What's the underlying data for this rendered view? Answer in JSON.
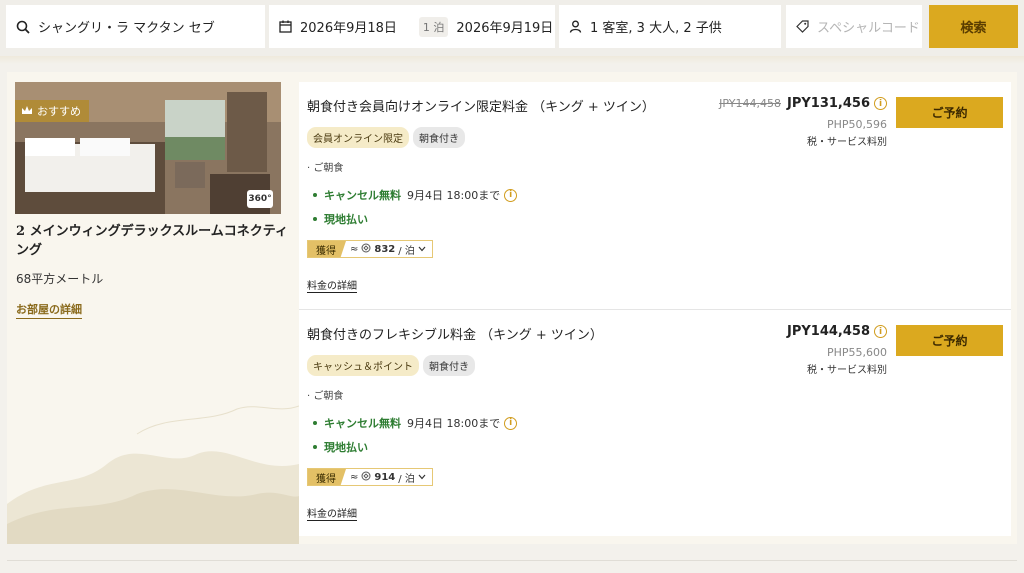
{
  "search": {
    "hotel": "シャングリ・ラ マクタン セブ",
    "checkin": "2026年9月18日",
    "nights": "1 泊",
    "checkout": "2026年9月19日",
    "guests": "1 客室, 3 大人, 2 子供",
    "code_placeholder": "スペシャルコード",
    "search_label": "検索"
  },
  "room": {
    "badge": "おすすめ",
    "name": "2 メインウィングデラックスルームコネクティング",
    "size": "68平方メートル",
    "details_link": "お部屋の詳細",
    "badge_360": "360°"
  },
  "rates": [
    {
      "title": "朝食付き会員向けオンライン限定料金 （キング + ツイン）",
      "tags": [
        "会員オンライン限定",
        "朝食付き"
      ],
      "breakfast": "· ご朝食",
      "cancel_label": "キャンセル無料",
      "cancel_date": "9月4日 18:00まで",
      "pay": "現地払い",
      "earn_label": "獲得",
      "earn_prefix": "≈",
      "earn_points": "832",
      "earn_unit": "/ 泊",
      "detail_link": "料金の詳細",
      "original_price": "JPY144,458",
      "price": "JPY131,456",
      "php": "PHP50,596",
      "tax": "税・サービス料別",
      "book_label": "ご予約"
    },
    {
      "title": "朝食付きのフレキシブル料金 （キング + ツイン）",
      "tags": [
        "キャッシュ＆ポイント",
        "朝食付き"
      ],
      "breakfast": "· ご朝食",
      "cancel_label": "キャンセル無料",
      "cancel_date": "9月4日 18:00まで",
      "pay": "現地払い",
      "earn_label": "獲得",
      "earn_prefix": "≈",
      "earn_points": "914",
      "earn_unit": "/ 泊",
      "detail_link": "料金の詳細",
      "original_price": "",
      "price": "JPY144,458",
      "php": "PHP55,600",
      "tax": "税・サービス料別",
      "book_label": "ご予約"
    }
  ],
  "colors": {
    "accent": "#dba91f",
    "badge": "#b08b38",
    "green": "#2e7d32",
    "card_bg": "#f9f6ee"
  },
  "icons": [
    "search-icon",
    "calendar-icon",
    "person-icon",
    "tag-icon",
    "crown-icon",
    "info-icon",
    "points-icon",
    "chevron-down-icon"
  ]
}
